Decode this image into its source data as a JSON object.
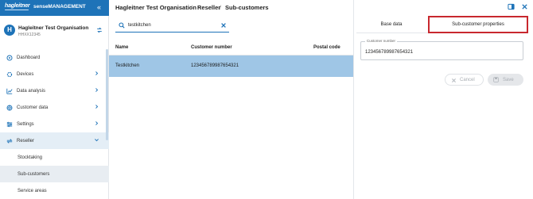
{
  "brand": {
    "logo": "hagleitner",
    "product": "senseMANAGEMENT"
  },
  "org": {
    "avatar": "H",
    "name": "Hagleitner Test Organisation",
    "id": "HHXX12345"
  },
  "nav": {
    "dashboard": "Dashboard",
    "devices": "Devices",
    "data_analysis": "Data analysis",
    "customer_data": "Customer data",
    "settings": "Settings",
    "reseller": "Reseller",
    "stocktaking": "Stocktaking",
    "sub_customers": "Sub-customers",
    "service_areas": "Service areas"
  },
  "breadcrumb": {
    "org": "Hagleitner Test Organisation",
    "reseller": "Reseller",
    "current": "Sub-customers",
    "sep": "/"
  },
  "search": {
    "value": "testkitchen"
  },
  "table": {
    "headers": {
      "name": "Name",
      "customer_number": "Customer number",
      "postal_code": "Postal code"
    },
    "rows": [
      {
        "name": "Testkitchen",
        "customer_number": "123456789987654321",
        "postal_code": ""
      }
    ]
  },
  "panel": {
    "tabs": {
      "base": "Base data",
      "sub": "Sub-customer properties"
    },
    "field_label": "Customer number",
    "field_value": "123456789987654321",
    "cancel": "Cancel",
    "save": "Save"
  },
  "colors": {
    "brand": "#1e73b8",
    "selected_row": "#9fc6e6",
    "highlight": "#c8282e"
  }
}
